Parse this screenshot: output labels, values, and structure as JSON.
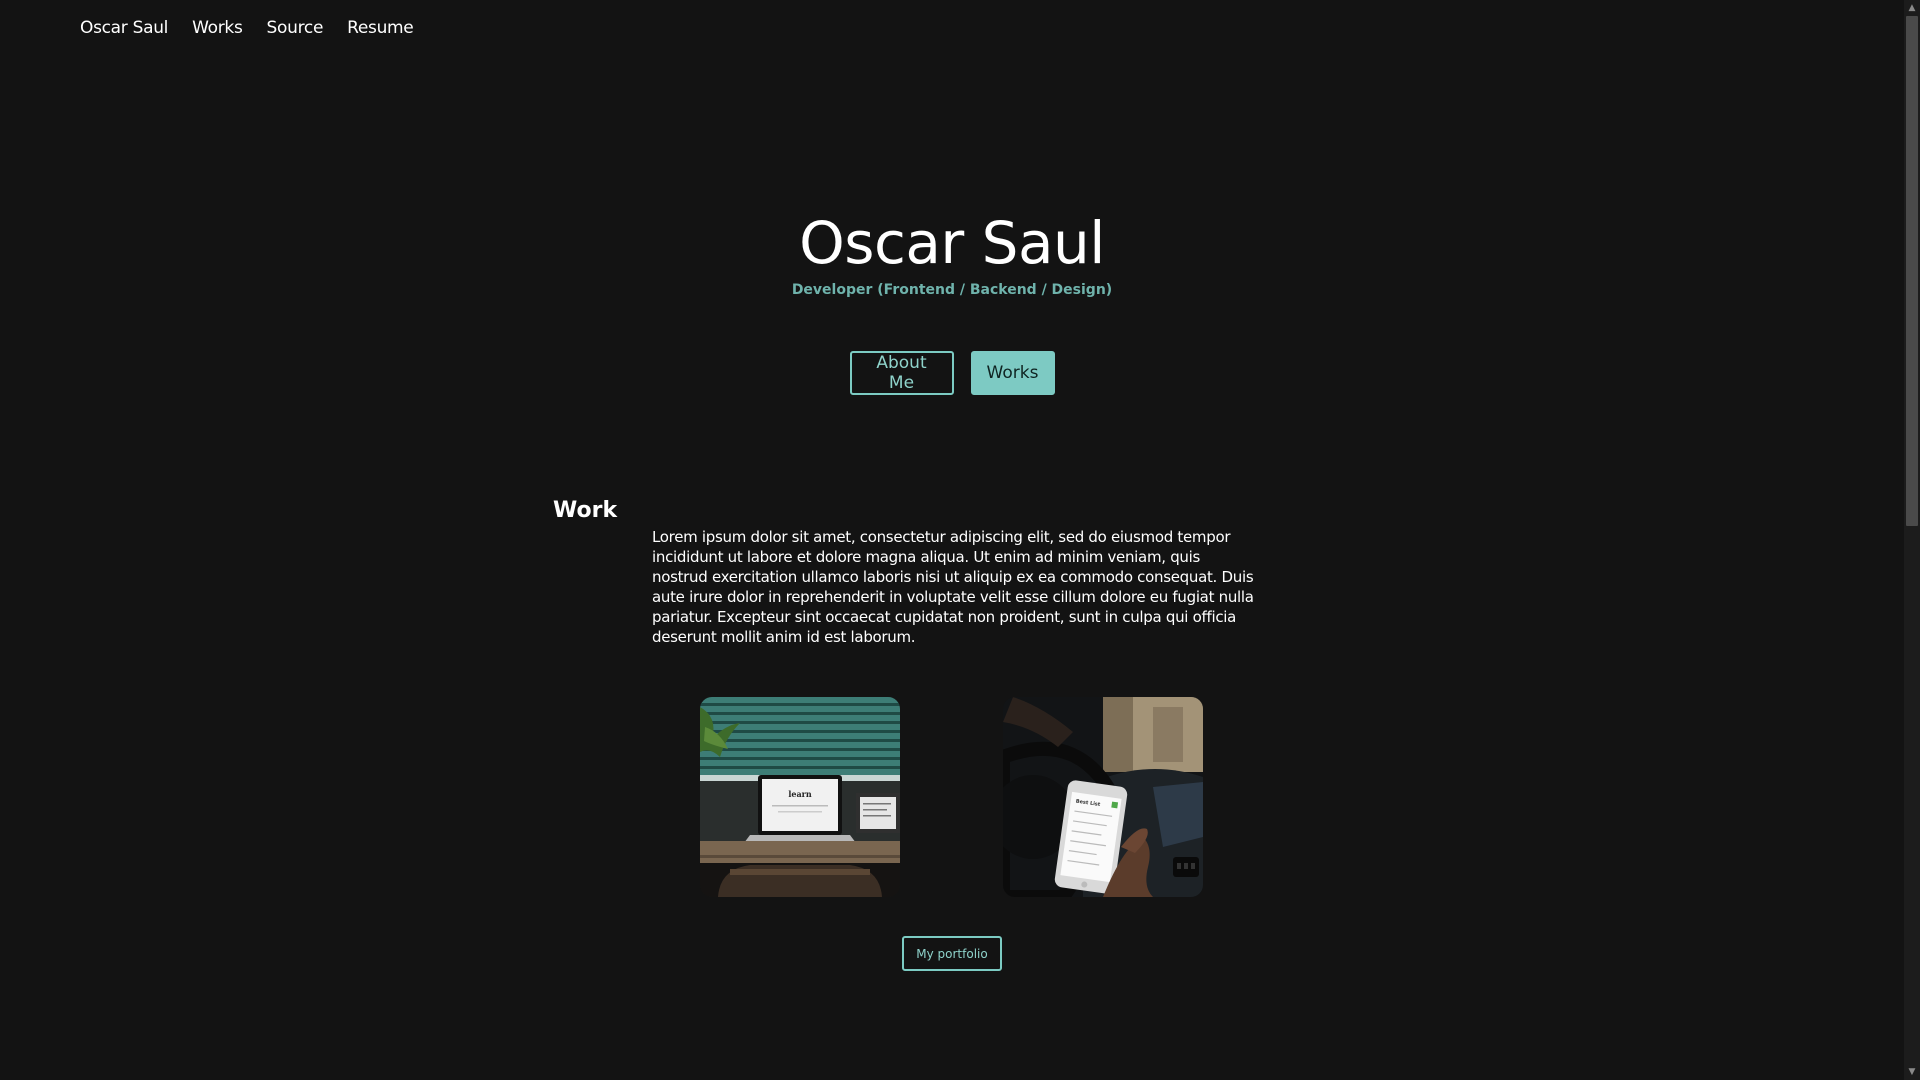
{
  "nav": {
    "items": [
      {
        "label": "Oscar Saul"
      },
      {
        "label": "Works"
      },
      {
        "label": "Source"
      },
      {
        "label": "Resume"
      }
    ]
  },
  "hero": {
    "title": "Oscar Saul",
    "subtitle": "Developer (Frontend / Backend / Design)",
    "about_label": "About Me",
    "works_label": "Works"
  },
  "work": {
    "heading": "Work",
    "body": "Lorem ipsum dolor sit amet, consectetur adipiscing elit, sed do eiusmod tempor incididunt ut labore et dolore magna aliqua. Ut enim ad minim veniam, quis nostrud exercitation ullamco laboris nisi ut aliquip ex ea commodo consequat. Duis aute irure dolor in reprehenderit in voluptate velit esse cillum dolore eu fugiat nulla pariatur. Excepteur sint occaecat cupidatat non proident, sunt in culpa qui officia deserunt mollit anim id est laborum.",
    "laptop_screen_text": "learn",
    "phone_screen_text": "Best List",
    "portfolio_label": "My portfolio"
  },
  "colors": {
    "background": "#131313",
    "accent": "#7dcac3",
    "subtitle": "#6fb3ac"
  }
}
